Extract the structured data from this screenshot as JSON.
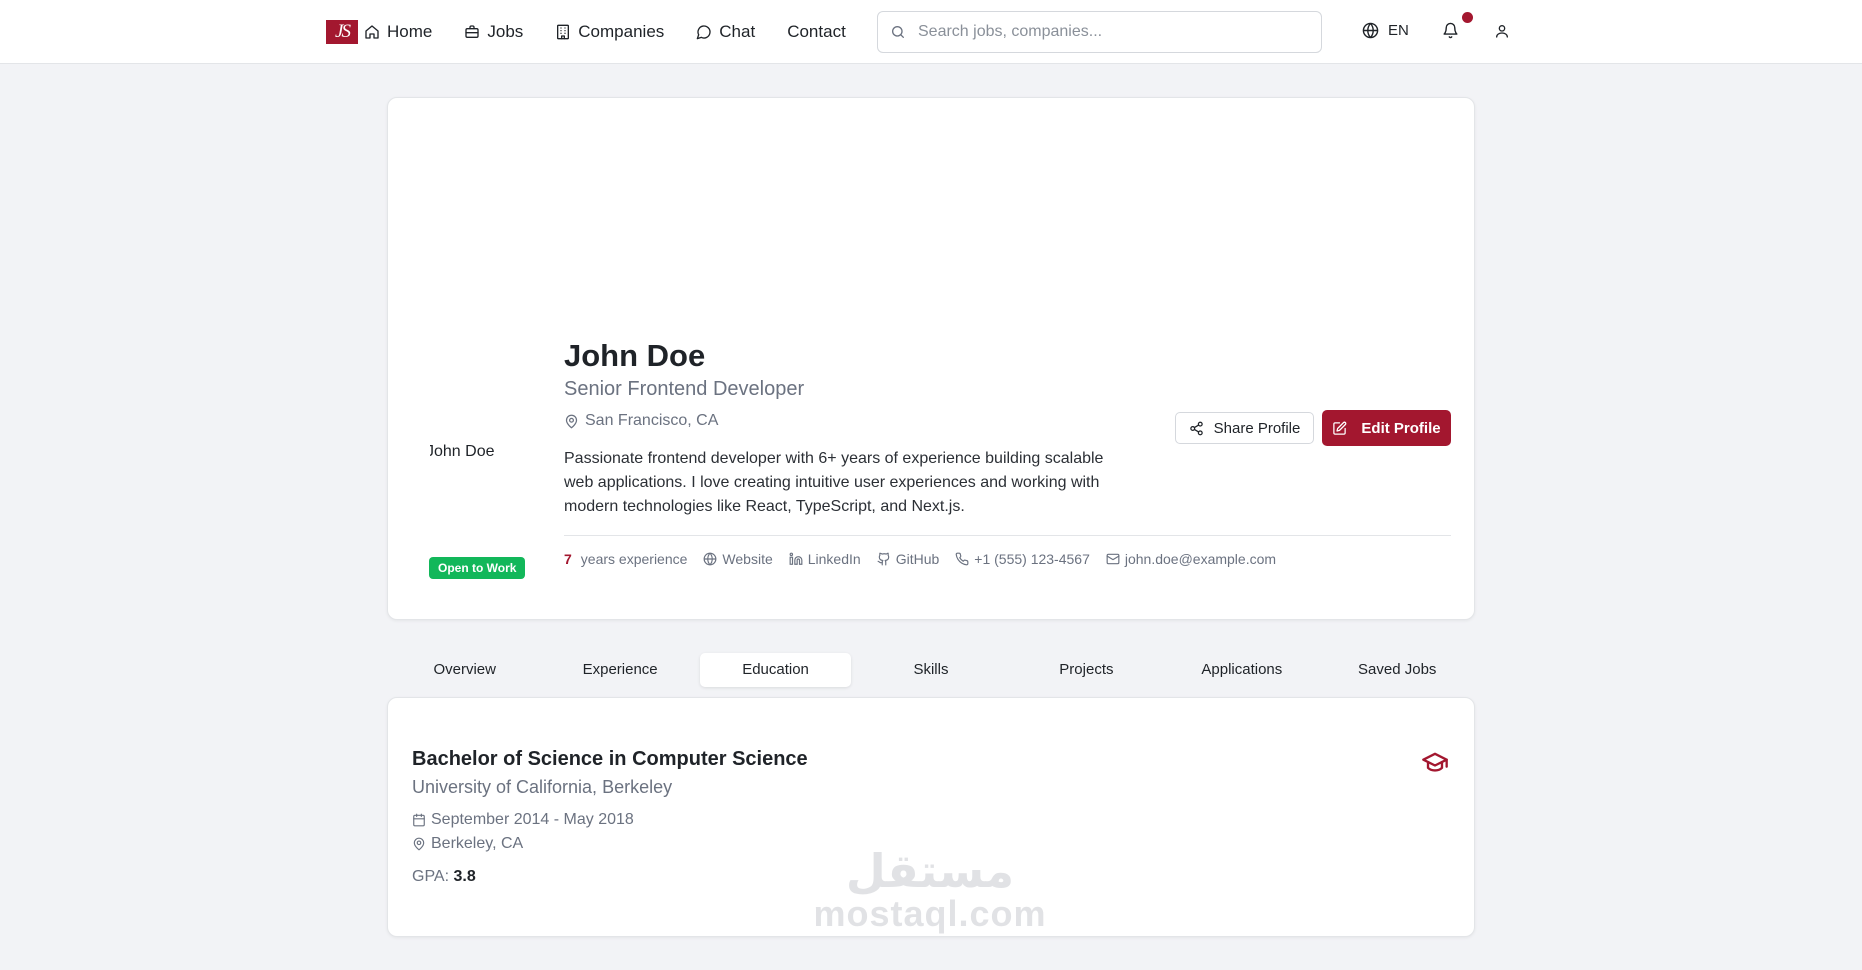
{
  "nav": {
    "logo_text": "JS",
    "links": [
      {
        "label": "Home",
        "icon": "home-icon"
      },
      {
        "label": "Jobs",
        "icon": "briefcase-icon"
      },
      {
        "label": "Companies",
        "icon": "building-icon"
      },
      {
        "label": "Chat",
        "icon": "chat-icon"
      },
      {
        "label": "Contact",
        "icon": ""
      }
    ],
    "search_placeholder": "Search jobs, companies...",
    "language": "EN",
    "notification_dot": true
  },
  "profile": {
    "avatar_alt": "John Doe",
    "status_badge": "Open to Work",
    "name": "John Doe",
    "title": "Senior Frontend Developer",
    "location": "San Francisco, CA",
    "bio": "Passionate frontend developer with 6+ years of experience building scalable web applications. I love creating intuitive user experiences and working with modern technologies like React, TypeScript, and Next.js.",
    "share_label": "Share Profile",
    "edit_label": "Edit Profile",
    "meta": {
      "experience_years": "7",
      "experience_suffix": "years experience",
      "website": "Website",
      "linkedin": "LinkedIn",
      "github": "GitHub",
      "phone": "+1 (555) 123-4567",
      "email": "john.doe@example.com"
    }
  },
  "tabs": [
    {
      "label": "Overview",
      "active": false
    },
    {
      "label": "Experience",
      "active": false
    },
    {
      "label": "Education",
      "active": true
    },
    {
      "label": "Skills",
      "active": false
    },
    {
      "label": "Projects",
      "active": false
    },
    {
      "label": "Applications",
      "active": false
    },
    {
      "label": "Saved Jobs",
      "active": false
    }
  ],
  "education": {
    "degree": "Bachelor of Science in Computer Science",
    "school": "University of California, Berkeley",
    "dates": "September 2014 - May 2018",
    "location": "Berkeley, CA",
    "gpa_label": "GPA:",
    "gpa_value": "3.8"
  },
  "watermark": {
    "arabic": "مستقل",
    "latin": "mostaql.com"
  },
  "colors": {
    "brand": "#a3172f",
    "success": "#12b75a",
    "muted_text": "#6b7280",
    "background": "#f2f3f6"
  }
}
